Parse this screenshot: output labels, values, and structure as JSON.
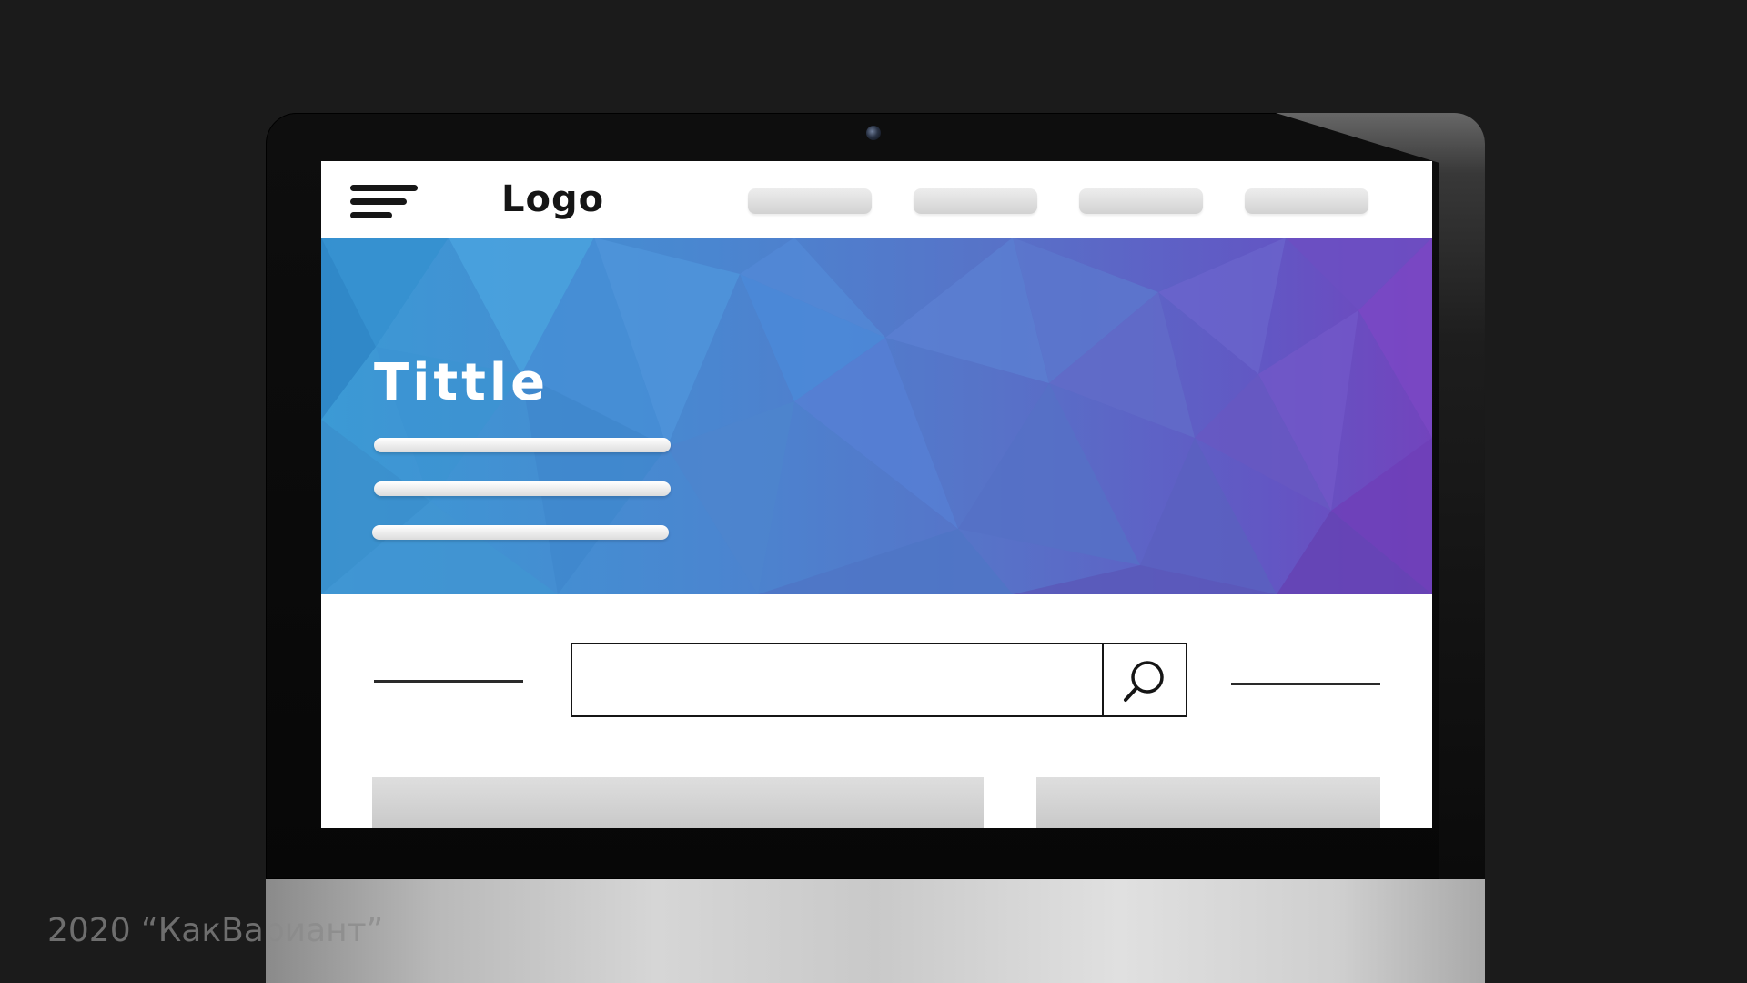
{
  "header": {
    "logo_text": "Logo",
    "nav_items": [
      "",
      "",
      "",
      ""
    ]
  },
  "hero": {
    "title": "Tittle",
    "colors": [
      "#3b9ad5",
      "#4a86d0",
      "#5773c8",
      "#6257c4",
      "#7244bd"
    ]
  },
  "search": {
    "value": "",
    "placeholder": ""
  },
  "icons": {
    "menu": "hamburger-menu-icon",
    "search": "magnifier-icon",
    "camera": "webcam-dot"
  },
  "watermark": {
    "text": "2020 “КакВариант”"
  }
}
